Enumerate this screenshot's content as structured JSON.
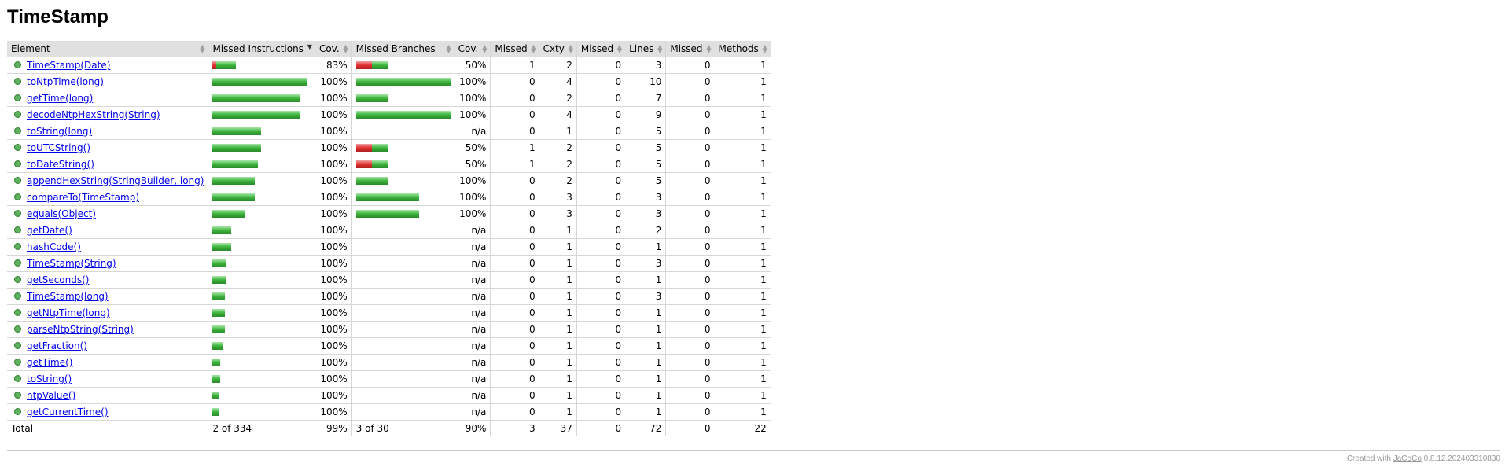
{
  "page": {
    "title": "TimeStamp"
  },
  "table": {
    "headers": [
      "Element",
      "Missed Instructions",
      "Cov.",
      "Missed Branches",
      "Cov.",
      "Missed",
      "Cxty",
      "Missed",
      "Lines",
      "Missed",
      "Methods"
    ],
    "sorted_column": "Missed Instructions",
    "sort_icon": "sort-descending-icon",
    "element_icon": "method-green-icon",
    "colors": {
      "covered": "#3cb43c",
      "missed": "#e03030"
    },
    "rows": [
      {
        "name": "TimeStamp(Date)",
        "instr_missed_frac": 0.17,
        "instr_bar_total": 30,
        "instr_cov": "83%",
        "branch_missed_frac": 0.5,
        "branch_bar_total": 40,
        "branch_cov": "50%",
        "cxty_missed": "1",
        "cxty": "2",
        "lines_missed": "0",
        "lines": "3",
        "methods_missed": "0",
        "methods": "1"
      },
      {
        "name": "toNtpTime(long)",
        "instr_missed_frac": 0,
        "instr_bar_total": 120,
        "instr_cov": "100%",
        "branch_missed_frac": 0,
        "branch_bar_total": 120,
        "branch_cov": "100%",
        "cxty_missed": "0",
        "cxty": "4",
        "lines_missed": "0",
        "lines": "10",
        "methods_missed": "0",
        "methods": "1"
      },
      {
        "name": "getTime(long)",
        "instr_missed_frac": 0,
        "instr_bar_total": 112,
        "instr_cov": "100%",
        "branch_missed_frac": 0,
        "branch_bar_total": 40,
        "branch_cov": "100%",
        "cxty_missed": "0",
        "cxty": "2",
        "lines_missed": "0",
        "lines": "7",
        "methods_missed": "0",
        "methods": "1"
      },
      {
        "name": "decodeNtpHexString(String)",
        "instr_missed_frac": 0,
        "instr_bar_total": 112,
        "instr_cov": "100%",
        "branch_missed_frac": 0,
        "branch_bar_total": 120,
        "branch_cov": "100%",
        "cxty_missed": "0",
        "cxty": "4",
        "lines_missed": "0",
        "lines": "9",
        "methods_missed": "0",
        "methods": "1"
      },
      {
        "name": "toString(long)",
        "instr_missed_frac": 0,
        "instr_bar_total": 62,
        "instr_cov": "100%",
        "branch_missed_frac": null,
        "branch_bar_total": 0,
        "branch_cov": "n/a",
        "cxty_missed": "0",
        "cxty": "1",
        "lines_missed": "0",
        "lines": "5",
        "methods_missed": "0",
        "methods": "1"
      },
      {
        "name": "toUTCString()",
        "instr_missed_frac": 0,
        "instr_bar_total": 62,
        "instr_cov": "100%",
        "branch_missed_frac": 0.5,
        "branch_bar_total": 40,
        "branch_cov": "50%",
        "cxty_missed": "1",
        "cxty": "2",
        "lines_missed": "0",
        "lines": "5",
        "methods_missed": "0",
        "methods": "1"
      },
      {
        "name": "toDateString()",
        "instr_missed_frac": 0,
        "instr_bar_total": 58,
        "instr_cov": "100%",
        "branch_missed_frac": 0.5,
        "branch_bar_total": 40,
        "branch_cov": "50%",
        "cxty_missed": "1",
        "cxty": "2",
        "lines_missed": "0",
        "lines": "5",
        "methods_missed": "0",
        "methods": "1"
      },
      {
        "name": "appendHexString(StringBuilder, long)",
        "instr_missed_frac": 0,
        "instr_bar_total": 54,
        "instr_cov": "100%",
        "branch_missed_frac": 0,
        "branch_bar_total": 40,
        "branch_cov": "100%",
        "cxty_missed": "0",
        "cxty": "2",
        "lines_missed": "0",
        "lines": "5",
        "methods_missed": "0",
        "methods": "1"
      },
      {
        "name": "compareTo(TimeStamp)",
        "instr_missed_frac": 0,
        "instr_bar_total": 54,
        "instr_cov": "100%",
        "branch_missed_frac": 0,
        "branch_bar_total": 80,
        "branch_cov": "100%",
        "cxty_missed": "0",
        "cxty": "3",
        "lines_missed": "0",
        "lines": "3",
        "methods_missed": "0",
        "methods": "1"
      },
      {
        "name": "equals(Object)",
        "instr_missed_frac": 0,
        "instr_bar_total": 42,
        "instr_cov": "100%",
        "branch_missed_frac": 0,
        "branch_bar_total": 80,
        "branch_cov": "100%",
        "cxty_missed": "0",
        "cxty": "3",
        "lines_missed": "0",
        "lines": "3",
        "methods_missed": "0",
        "methods": "1"
      },
      {
        "name": "getDate()",
        "instr_missed_frac": 0,
        "instr_bar_total": 24,
        "instr_cov": "100%",
        "branch_missed_frac": null,
        "branch_bar_total": 0,
        "branch_cov": "n/a",
        "cxty_missed": "0",
        "cxty": "1",
        "lines_missed": "0",
        "lines": "2",
        "methods_missed": "0",
        "methods": "1"
      },
      {
        "name": "hashCode()",
        "instr_missed_frac": 0,
        "instr_bar_total": 24,
        "instr_cov": "100%",
        "branch_missed_frac": null,
        "branch_bar_total": 0,
        "branch_cov": "n/a",
        "cxty_missed": "0",
        "cxty": "1",
        "lines_missed": "0",
        "lines": "1",
        "methods_missed": "0",
        "methods": "1"
      },
      {
        "name": "TimeStamp(String)",
        "instr_missed_frac": 0,
        "instr_bar_total": 18,
        "instr_cov": "100%",
        "branch_missed_frac": null,
        "branch_bar_total": 0,
        "branch_cov": "n/a",
        "cxty_missed": "0",
        "cxty": "1",
        "lines_missed": "0",
        "lines": "3",
        "methods_missed": "0",
        "methods": "1"
      },
      {
        "name": "getSeconds()",
        "instr_missed_frac": 0,
        "instr_bar_total": 18,
        "instr_cov": "100%",
        "branch_missed_frac": null,
        "branch_bar_total": 0,
        "branch_cov": "n/a",
        "cxty_missed": "0",
        "cxty": "1",
        "lines_missed": "0",
        "lines": "1",
        "methods_missed": "0",
        "methods": "1"
      },
      {
        "name": "TimeStamp(long)",
        "instr_missed_frac": 0,
        "instr_bar_total": 16,
        "instr_cov": "100%",
        "branch_missed_frac": null,
        "branch_bar_total": 0,
        "branch_cov": "n/a",
        "cxty_missed": "0",
        "cxty": "1",
        "lines_missed": "0",
        "lines": "3",
        "methods_missed": "0",
        "methods": "1"
      },
      {
        "name": "getNtpTime(long)",
        "instr_missed_frac": 0,
        "instr_bar_total": 16,
        "instr_cov": "100%",
        "branch_missed_frac": null,
        "branch_bar_total": 0,
        "branch_cov": "n/a",
        "cxty_missed": "0",
        "cxty": "1",
        "lines_missed": "0",
        "lines": "1",
        "methods_missed": "0",
        "methods": "1"
      },
      {
        "name": "parseNtpString(String)",
        "instr_missed_frac": 0,
        "instr_bar_total": 16,
        "instr_cov": "100%",
        "branch_missed_frac": null,
        "branch_bar_total": 0,
        "branch_cov": "n/a",
        "cxty_missed": "0",
        "cxty": "1",
        "lines_missed": "0",
        "lines": "1",
        "methods_missed": "0",
        "methods": "1"
      },
      {
        "name": "getFraction()",
        "instr_missed_frac": 0,
        "instr_bar_total": 13,
        "instr_cov": "100%",
        "branch_missed_frac": null,
        "branch_bar_total": 0,
        "branch_cov": "n/a",
        "cxty_missed": "0",
        "cxty": "1",
        "lines_missed": "0",
        "lines": "1",
        "methods_missed": "0",
        "methods": "1"
      },
      {
        "name": "getTime()",
        "instr_missed_frac": 0,
        "instr_bar_total": 10,
        "instr_cov": "100%",
        "branch_missed_frac": null,
        "branch_bar_total": 0,
        "branch_cov": "n/a",
        "cxty_missed": "0",
        "cxty": "1",
        "lines_missed": "0",
        "lines": "1",
        "methods_missed": "0",
        "methods": "1"
      },
      {
        "name": "toString()",
        "instr_missed_frac": 0,
        "instr_bar_total": 10,
        "instr_cov": "100%",
        "branch_missed_frac": null,
        "branch_bar_total": 0,
        "branch_cov": "n/a",
        "cxty_missed": "0",
        "cxty": "1",
        "lines_missed": "0",
        "lines": "1",
        "methods_missed": "0",
        "methods": "1"
      },
      {
        "name": "ntpValue()",
        "instr_missed_frac": 0,
        "instr_bar_total": 8,
        "instr_cov": "100%",
        "branch_missed_frac": null,
        "branch_bar_total": 0,
        "branch_cov": "n/a",
        "cxty_missed": "0",
        "cxty": "1",
        "lines_missed": "0",
        "lines": "1",
        "methods_missed": "0",
        "methods": "1"
      },
      {
        "name": "getCurrentTime()",
        "instr_missed_frac": 0,
        "instr_bar_total": 8,
        "instr_cov": "100%",
        "branch_missed_frac": null,
        "branch_bar_total": 0,
        "branch_cov": "n/a",
        "cxty_missed": "0",
        "cxty": "1",
        "lines_missed": "0",
        "lines": "1",
        "methods_missed": "0",
        "methods": "1"
      }
    ],
    "total": {
      "label": "Total",
      "instr": "2 of 334",
      "instr_cov": "99%",
      "branch": "3 of 30",
      "branch_cov": "90%",
      "cxty_missed": "3",
      "cxty": "37",
      "lines_missed": "0",
      "lines": "72",
      "methods_missed": "0",
      "methods": "22"
    }
  },
  "footer": {
    "prefix": "Created with ",
    "link": "JaCoCo",
    "suffix": " 0.8.12.202403310830"
  }
}
